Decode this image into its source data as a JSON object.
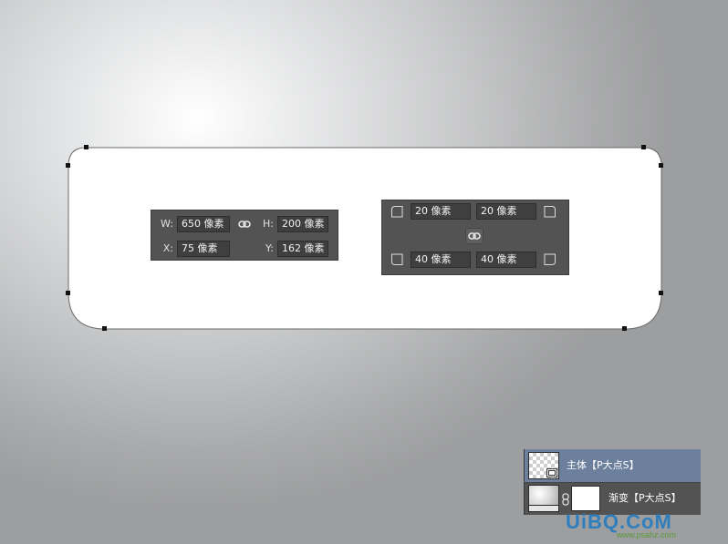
{
  "transform_panel": {
    "w_label": "W:",
    "w_value": "650 像素",
    "h_label": "H:",
    "h_value": "200 像素",
    "x_label": "X:",
    "x_value": "75 像素",
    "y_label": "Y:",
    "y_value": "162 像素",
    "link_icon": "link-icon"
  },
  "corner_panel": {
    "top_left": "20 像素",
    "top_right": "20 像素",
    "bottom_left": "40 像素",
    "bottom_right": "40 像素",
    "link_icon": "link-icon"
  },
  "layers": [
    {
      "name": "主体【P大点S】",
      "selected": true,
      "thumb": "transparent-shape-thumbnail"
    },
    {
      "name": "渐变【P大点S】",
      "selected": false,
      "thumb": "gradient-thumbnail"
    }
  ],
  "watermark": {
    "main": "UiBQ.CoM",
    "sub": "www.psahz.com"
  },
  "colors": {
    "panel_bg": "#535353",
    "field_bg": "#3f3f3f",
    "selected_layer": "#6c7f9c",
    "shape_fill": "#ffffff"
  }
}
